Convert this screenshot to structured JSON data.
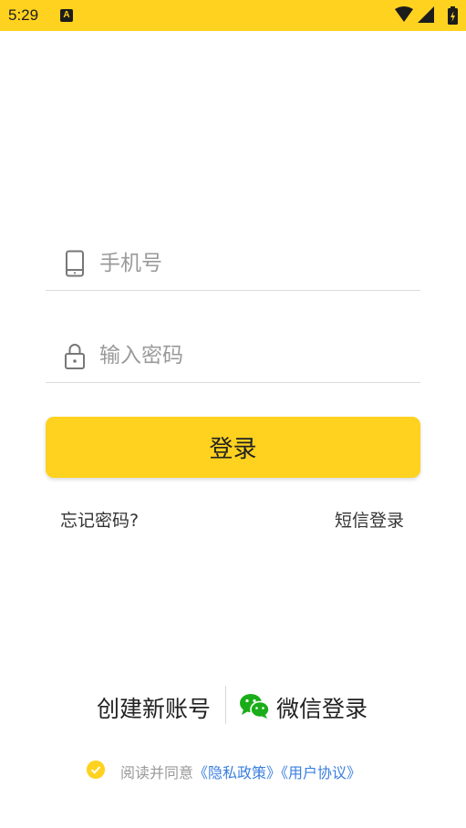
{
  "status_bar": {
    "time": "5:29",
    "notification_icon_letter": "A",
    "icons": [
      "wifi-icon",
      "signal-icon",
      "battery-icon"
    ]
  },
  "form": {
    "phone_placeholder": "手机号",
    "password_placeholder": "输入密码",
    "login_label": "登录",
    "forgot_password": "忘记密码?",
    "sms_login": "短信登录"
  },
  "bottom": {
    "create_account": "创建新账号",
    "wechat_login": "微信登录"
  },
  "agreement": {
    "prefix": "阅读并同意",
    "privacy_policy": "《隐私政策》",
    "user_agreement": "《用户协议》"
  },
  "colors": {
    "brand_yellow": "#FFD21F",
    "link_blue": "#3B7FE0",
    "wechat_green": "#1AAD19"
  }
}
